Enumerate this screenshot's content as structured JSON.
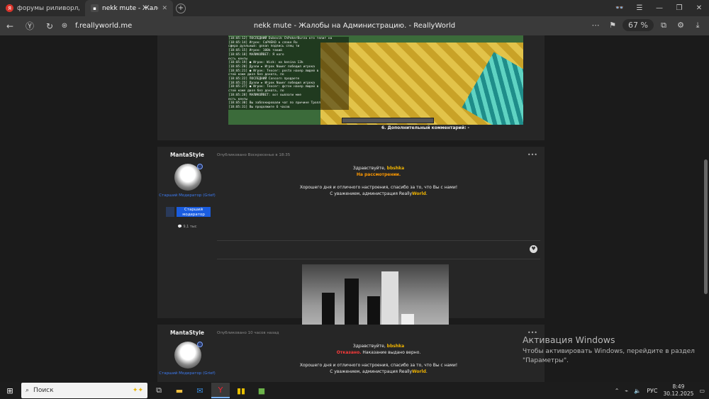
{
  "tabs": [
    {
      "title": "форумы риливорлд — Ян",
      "icon": "yandex-icon",
      "active": false
    },
    {
      "title": "nekk mute - Жалобы на",
      "icon": "realityworld-icon",
      "active": true
    }
  ],
  "address_bar": {
    "url": "f.reallyworld.me",
    "page_title": "nekk mute - Жалобы на Администрацию. - ReallyWorld",
    "zoom": "67 %"
  },
  "post1": {
    "additional_comment": "6. Дополнительный комментарий: -",
    "chat_lines": [
      "[18:05:12] ПОСЛЕДНИЙ Dubovik ChPokerBurza кто телит на",
      "[18:05:14] Игрок: СаРНЕКО в слове Ru",
      "сфера дуэльный: gonan подпись спец ти",
      "[18:05:15] Игрок: 100k такий",
      "[18:05:18] МАЛИКОЙВЕТ: Я кого",
      "есть кенты",
      "[18:05:19] ● Игрок: Wick: на kenina 13k",
      "[18:05:20] Дуэли ► Игрок Nuwer победил игрока",
      "[18:05:21] ● Игрок: Texcer: роstо нахер людей в",
      "стой коже двоя без доната, по",
      "[18:05:22] ПОСЛЕДНИЙ Consorn продаете",
      "[18:05:25] Дуэли ► Игрок Nuwer победил игрока",
      "[18:05:27] ● Игрок: Texcer: фстон нахер людей в",
      "стой коже двоя без доната, по",
      "[18:05:28] МАЛИКОЙВЕТ: вот выплати мне",
      "есть кенты",
      "[18:05:30] Вы заблокировали чат по причине Тролл",
      "[18:05:31] Вы продолжите 6 часов"
    ]
  },
  "post2": {
    "author": "MantaStyle",
    "role": "Старший Модератор (Grief)",
    "badge": "Старший модератор",
    "messages": "9,1 тыс",
    "date": "Опубликовано Воскресенье в 18:35",
    "greeting_prefix": "Здравствуйте,",
    "username": "bbshka",
    "status": "На рассмотрении.",
    "body": "Хорошего дня и отличного настроения, спасибо за то, что Вы с нами!",
    "signoff_prefix": "С уважением, администрация Really",
    "signoff_brand": "World",
    "signoff_suffix": "."
  },
  "post3": {
    "author": "MantaStyle",
    "role": "Старший Модератор (Grief)",
    "date": "Опубликовано 10 часов назад",
    "greeting_prefix": "Здравствуйте,",
    "username": "bbshka",
    "status": "Отказано.",
    "status_detail": "Наказание выдано верно.",
    "body": "Хорошего дня и отличного настроения, спасибо за то, что Вы с нами!",
    "signoff_prefix": "С уважением, администрация Really",
    "signoff_brand": "World",
    "signoff_suffix": "."
  },
  "watermark": {
    "title": "Активация Windows",
    "line1": "Чтобы активировать Windows, перейдите в раздел",
    "line2": "\"Параметры\"."
  },
  "taskbar": {
    "search_placeholder": "Поиск",
    "lang": "РУС",
    "time": "8:49",
    "date": "30.12.2025"
  },
  "colors": {
    "accent_blue": "#1a5de0",
    "highlight_yellow": "#f0b400",
    "status_orange": "#ff9900",
    "status_red": "#ff3b3b"
  }
}
